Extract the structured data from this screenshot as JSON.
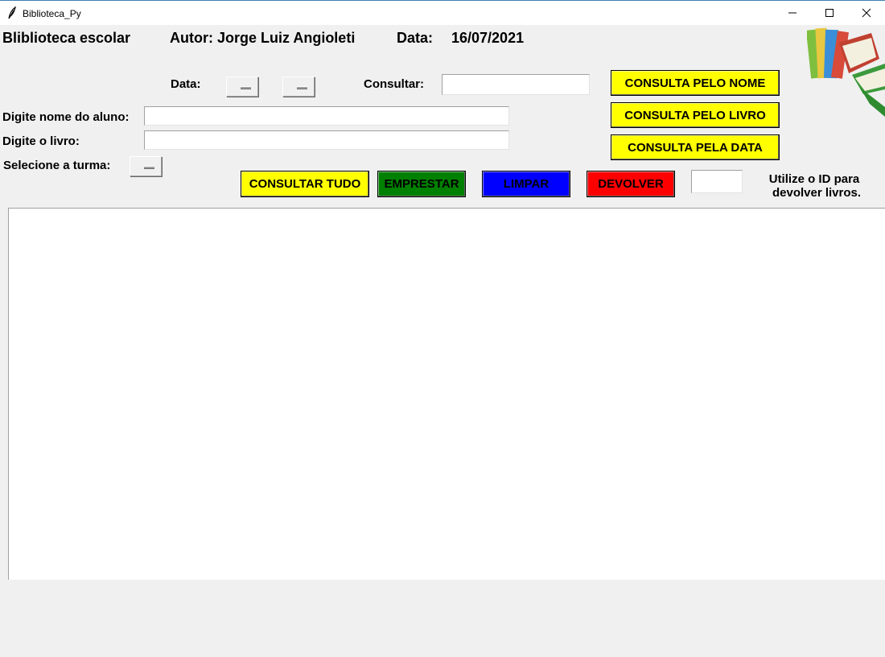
{
  "window": {
    "title": "Biblioteca_Py"
  },
  "header": {
    "app_name": "Bliblioteca escolar",
    "author": "Autor: Jorge Luiz Angioleti",
    "date_label": "Data:",
    "date_value": "16/07/2021"
  },
  "form": {
    "data_label": "Data:",
    "consultar_label": "Consultar:",
    "consultar_value": "",
    "aluno_label": "Digite nome do aluno:",
    "aluno_value": "",
    "livro_label": "Digite o livro:",
    "livro_value": "",
    "turma_label": "Selecione a turma:",
    "id_value": ""
  },
  "buttons": {
    "consulta_nome": "CONSULTA PELO NOME",
    "consulta_livro": "CONSULTA PELO LIVRO",
    "consulta_data": "CONSULTA PELA DATA",
    "consultar_tudo": "CONSULTAR TUDO",
    "emprestar": "EMPRESTAR",
    "limpar": "LIMPAR",
    "devolver": "DEVOLVER"
  },
  "hint": {
    "line1": "Utilize o ID para",
    "line2": "devolver livros."
  },
  "icons": {
    "app": "feather-icon",
    "logo": "books-icon"
  },
  "colors": {
    "yellow": "#ffff00",
    "green": "#008000",
    "blue": "#0000ff",
    "red": "#ff0000"
  },
  "results": {
    "content": ""
  }
}
